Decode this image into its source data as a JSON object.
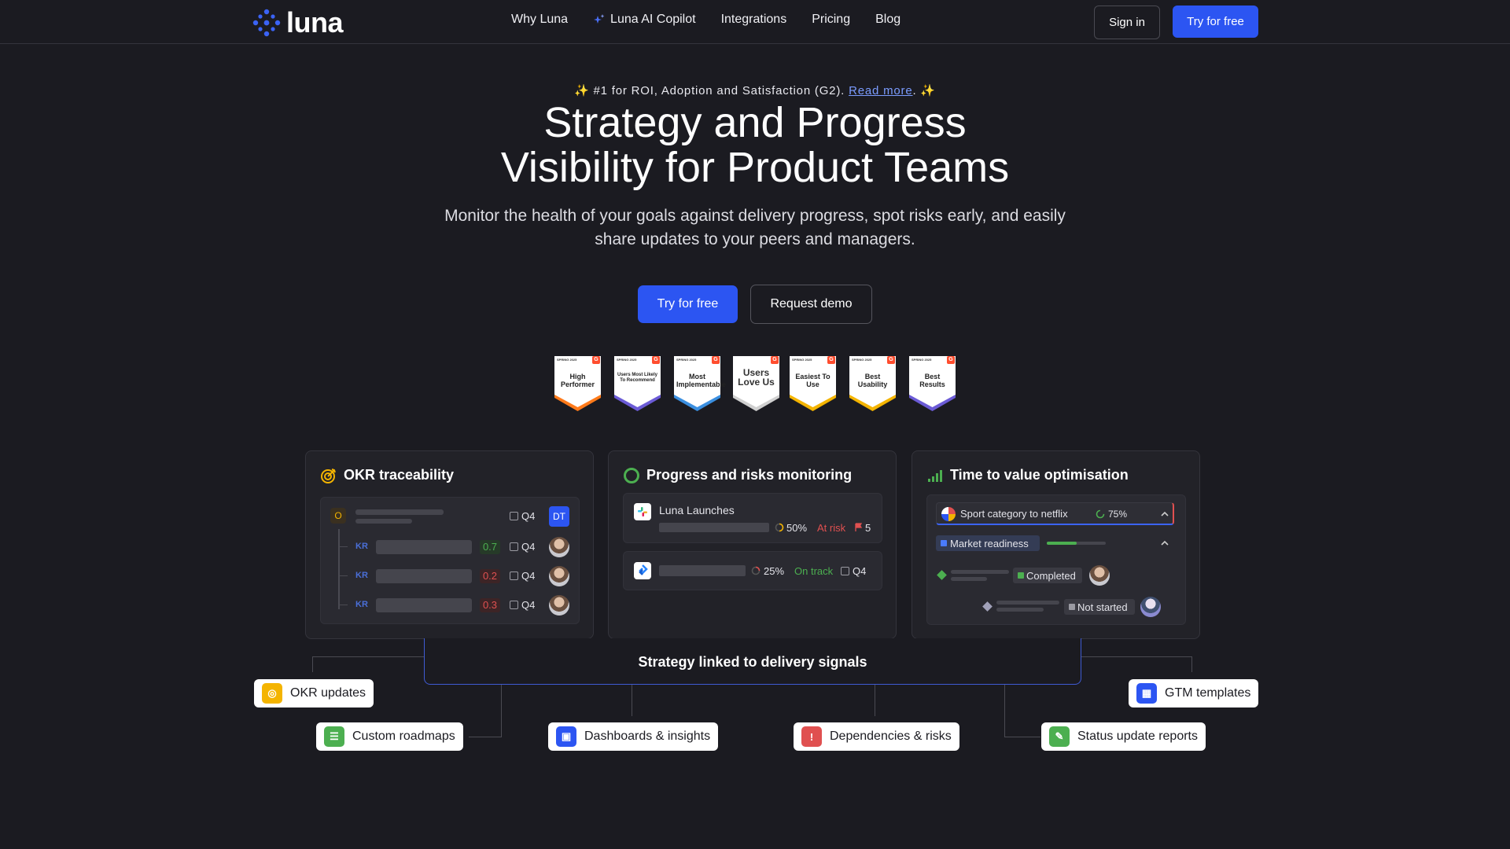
{
  "brand": {
    "name": "luna",
    "accent": "#2c55f2",
    "background": "#1b1b21"
  },
  "nav": {
    "links": [
      "Why Luna",
      "Luna AI Copilot",
      "Integrations",
      "Pricing",
      "Blog"
    ],
    "sign_in": "Sign in",
    "try_free": "Try for free"
  },
  "hero": {
    "tagline_prefix": "✨ #1 for ROI, Adoption and Satisfaction (G2).",
    "tagline_link": "Read more",
    "tagline_suffix": ". ✨",
    "headline_line1": "Strategy and Progress",
    "headline_line2": "Visibility for Product Teams",
    "subhead": "Monitor the health of your goals against delivery progress, spot risks early, and easily share updates to your peers and managers.",
    "cta_primary": "Try for free",
    "cta_secondary": "Request demo"
  },
  "badges": [
    {
      "season": "SPRING 2025",
      "label": "High Performer",
      "color": "#ff7a1a"
    },
    {
      "season": "SPRING 2025",
      "label": "Users Most Likely To Recommend",
      "color": "#6b5bd6"
    },
    {
      "season": "SPRING 2025",
      "label": "Most Implementable",
      "color": "#3b8fe0"
    },
    {
      "season": "",
      "label": "Users Love Us",
      "color": "#d0d0d0"
    },
    {
      "season": "SPRING 2025",
      "label": "Easiest To Use",
      "color": "#f4b400"
    },
    {
      "season": "SPRING 2025",
      "label": "Best Usability",
      "color": "#f4b400"
    },
    {
      "season": "SPRING 2025",
      "label": "Best Results",
      "color": "#6b5bd6"
    }
  ],
  "cards": {
    "okr": {
      "title": "OKR traceability",
      "objective": {
        "tag": "O",
        "quarter": "Q4",
        "owner": "DT"
      },
      "key_results": [
        {
          "tag": "KR",
          "score": "0.7",
          "quarter": "Q4",
          "status_color": "#4caf50"
        },
        {
          "tag": "KR",
          "score": "0.2",
          "quarter": "Q4",
          "status_color": "#e05050"
        },
        {
          "tag": "KR",
          "score": "0.3",
          "quarter": "Q4",
          "status_color": "#e05050"
        }
      ]
    },
    "progress": {
      "title": "Progress and risks monitoring",
      "rows": [
        {
          "name": "Luna Launches",
          "percent": "50%",
          "status": "At risk",
          "flags": "5",
          "status_color": "#e05050"
        },
        {
          "name": "",
          "percent": "25%",
          "status": "On track",
          "quarter": "Q4",
          "status_color": "#4caf50"
        }
      ]
    },
    "ttv": {
      "title": "Time to value optimisation",
      "item": "Sport category to netflix",
      "item_percent": "75%",
      "sub": "Market readiness",
      "statuses": [
        "Completed",
        "Not started"
      ]
    }
  },
  "strategy_label": "Strategy linked to delivery signals",
  "chips": {
    "okr_updates": "OKR updates",
    "gtm_templates": "GTM templates",
    "custom_roadmaps": "Custom roadmaps",
    "dashboards": "Dashboards & insights",
    "dependencies": "Dependencies & risks",
    "status_reports": "Status update reports"
  }
}
